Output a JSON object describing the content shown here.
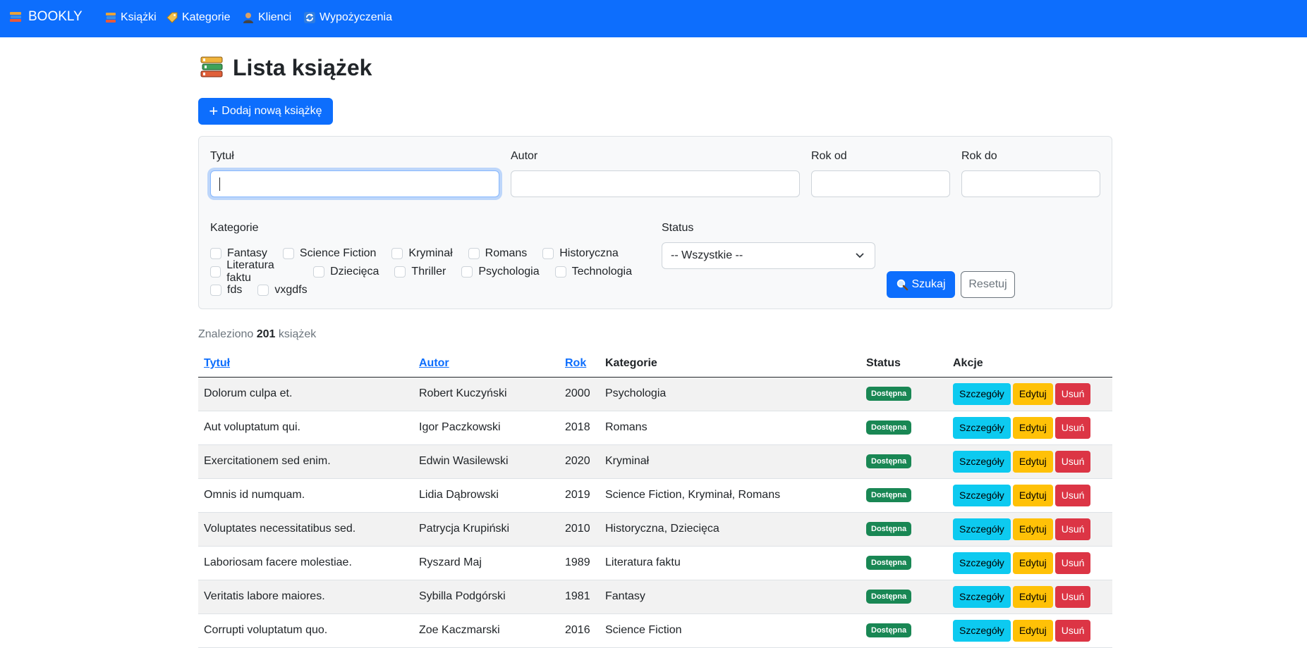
{
  "navbar": {
    "brand": "BOOKLY",
    "items": [
      {
        "label": "Książki",
        "icon": "books-icon"
      },
      {
        "label": "Kategorie",
        "icon": "tag-icon"
      },
      {
        "label": "Klienci",
        "icon": "user-icon"
      },
      {
        "label": "Wypożyczenia",
        "icon": "refresh-icon"
      }
    ]
  },
  "page": {
    "title": "Lista książek",
    "add_button": "Dodaj nową książkę"
  },
  "filters": {
    "title_label": "Tytuł",
    "title_value": "",
    "author_label": "Autor",
    "author_value": "",
    "year_from_label": "Rok od",
    "year_from_value": "",
    "year_to_label": "Rok do",
    "year_to_value": "",
    "categories_label": "Kategorie",
    "categories": [
      [
        "Fantasy",
        "Science Fiction",
        "Kryminał",
        "Romans",
        "Historyczna"
      ],
      [
        "Literatura faktu",
        "Dziecięca",
        "Thriller",
        "Psychologia",
        "Technologia"
      ],
      [
        "fds",
        "vxgdfs"
      ]
    ],
    "status_label": "Status",
    "status_selected": "-- Wszystkie --",
    "search_button": "Szukaj",
    "reset_button": "Resetuj"
  },
  "results": {
    "prefix": "Znaleziono",
    "count": "201",
    "suffix": "książek"
  },
  "table": {
    "headers": {
      "title": "Tytuł",
      "author": "Autor",
      "year": "Rok",
      "categories": "Kategorie",
      "status": "Status",
      "actions": "Akcje"
    },
    "action_labels": {
      "details": "Szczegóły",
      "edit": "Edytuj",
      "delete": "Usuń"
    },
    "rows": [
      {
        "title": "Dolorum culpa et.",
        "author": "Robert Kuczyński",
        "year": "2000",
        "categories": "Psychologia",
        "status": "Dostępna"
      },
      {
        "title": "Aut voluptatum qui.",
        "author": "Igor Paczkowski",
        "year": "2018",
        "categories": "Romans",
        "status": "Dostępna"
      },
      {
        "title": "Exercitationem sed enim.",
        "author": "Edwin Wasilewski",
        "year": "2020",
        "categories": "Kryminał",
        "status": "Dostępna"
      },
      {
        "title": "Omnis id numquam.",
        "author": "Lidia Dąbrowski",
        "year": "2019",
        "categories": "Science Fiction, Kryminał, Romans",
        "status": "Dostępna"
      },
      {
        "title": "Voluptates necessitatibus sed.",
        "author": "Patrycja Krupiński",
        "year": "2010",
        "categories": "Historyczna, Dziecięca",
        "status": "Dostępna"
      },
      {
        "title": "Laboriosam facere molestiae.",
        "author": "Ryszard Maj",
        "year": "1989",
        "categories": "Literatura faktu",
        "status": "Dostępna"
      },
      {
        "title": "Veritatis labore maiores.",
        "author": "Sybilla Podgórski",
        "year": "1981",
        "categories": "Fantasy",
        "status": "Dostępna"
      },
      {
        "title": "Corrupti voluptatum quo.",
        "author": "Zoe Kaczmarski",
        "year": "2016",
        "categories": "Science Fiction",
        "status": "Dostępna"
      }
    ]
  },
  "colors": {
    "primary": "#0d6efd",
    "success": "#198754",
    "info": "#0dcaf0",
    "warning": "#ffc107",
    "danger": "#dc3545"
  }
}
